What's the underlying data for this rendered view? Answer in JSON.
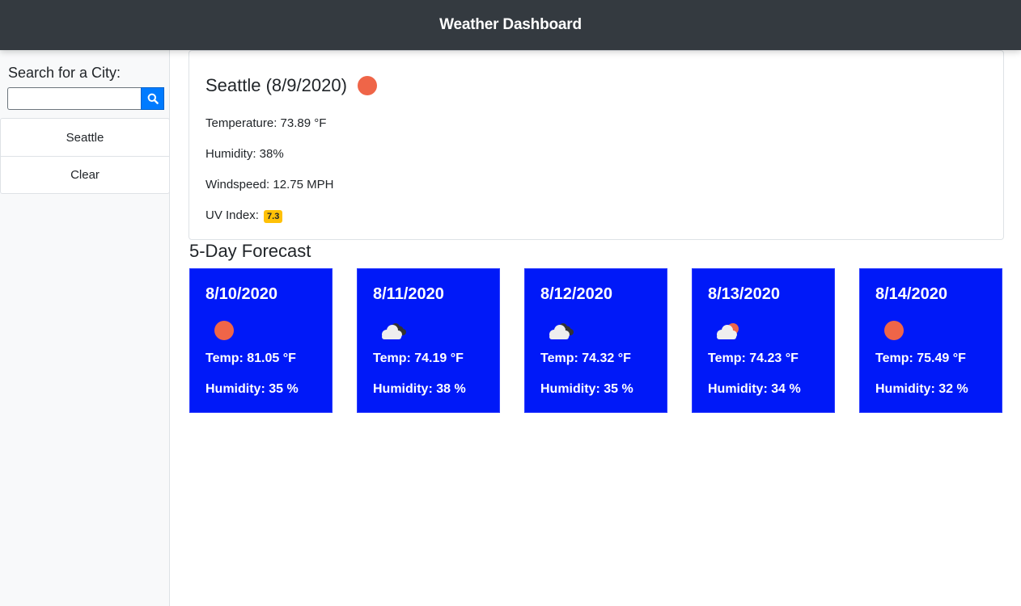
{
  "header": {
    "title": "Weather Dashboard"
  },
  "sidebar": {
    "search_label": "Search for a City:",
    "search_value": "",
    "search_placeholder": "",
    "search_icon": "search-icon",
    "history": [
      {
        "label": "Seattle"
      },
      {
        "label": "Clear"
      }
    ]
  },
  "current": {
    "title": "Seattle (8/9/2020)",
    "icon": "sun-icon",
    "temperature": "Temperature: 73.89 °F",
    "humidity": "Humidity: 38%",
    "windspeed": "Windspeed: 12.75 MPH",
    "uv_label": "UV Index:",
    "uv_value": "7.3",
    "uv_color": "#ffc107"
  },
  "forecast": {
    "title": "5-Day Forecast",
    "card_color": "#0019f8",
    "days": [
      {
        "date": "8/10/2020",
        "icon": "sun-icon",
        "temp": "Temp: 81.05 °F",
        "humidity": "Humidity: 35 %"
      },
      {
        "date": "8/11/2020",
        "icon": "cloudy-icon",
        "temp": "Temp: 74.19 °F",
        "humidity": "Humidity: 38 %"
      },
      {
        "date": "8/12/2020",
        "icon": "cloudy-icon",
        "temp": "Temp: 74.32 °F",
        "humidity": "Humidity: 35 %"
      },
      {
        "date": "8/13/2020",
        "icon": "partly-cloudy-icon",
        "temp": "Temp: 74.23 °F",
        "humidity": "Humidity: 34 %"
      },
      {
        "date": "8/14/2020",
        "icon": "sun-icon",
        "temp": "Temp: 75.49 °F",
        "humidity": "Humidity: 32 %"
      }
    ]
  }
}
